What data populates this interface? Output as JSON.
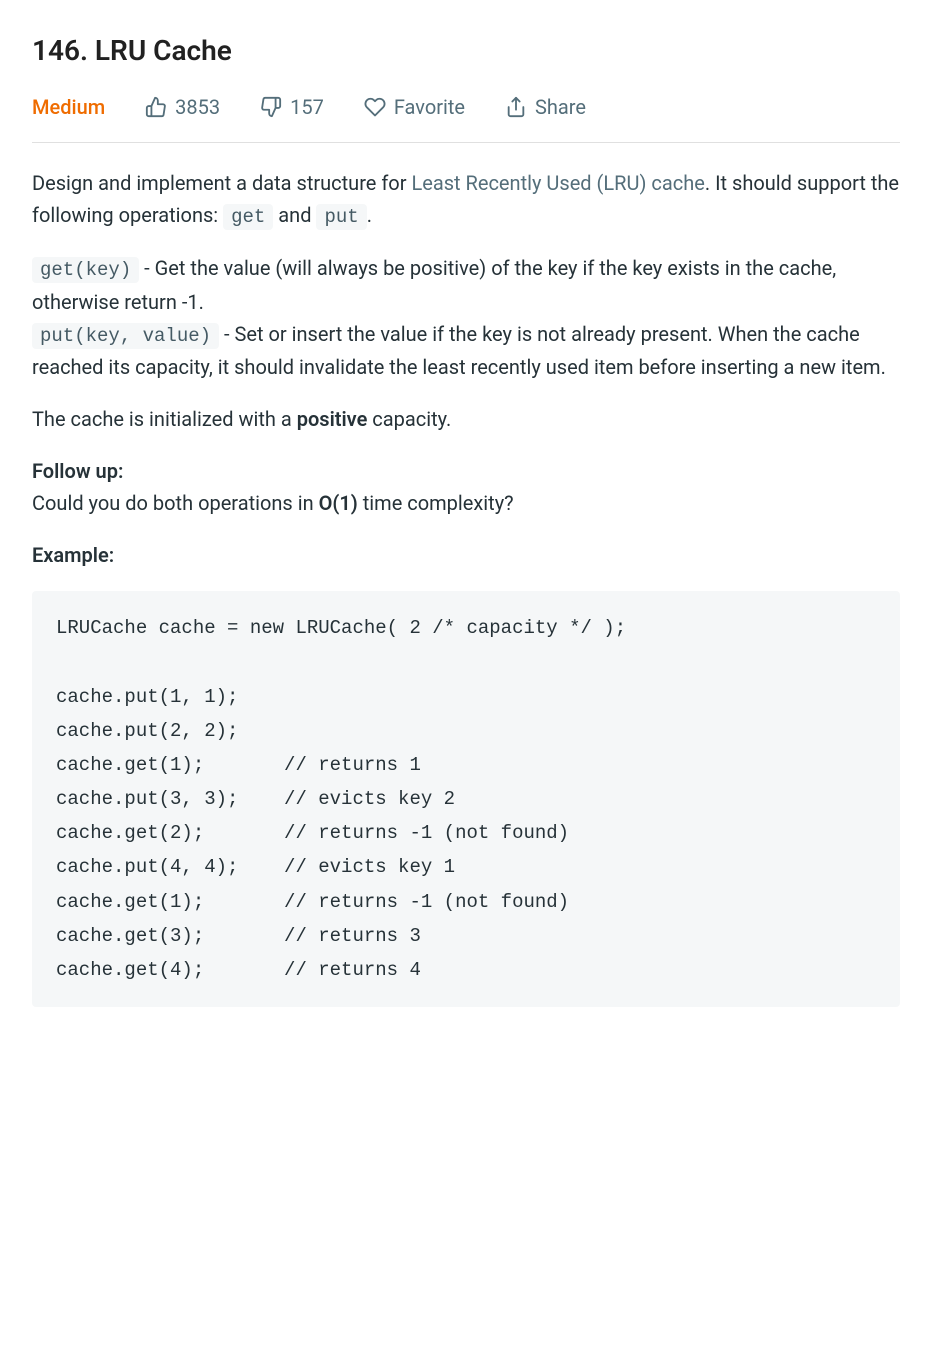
{
  "title": "146. LRU Cache",
  "meta": {
    "difficulty": "Medium",
    "likes": "3853",
    "dislikes": "157",
    "favorite": "Favorite",
    "share": "Share"
  },
  "body": {
    "intro_prefix": "Design and implement a data structure for ",
    "intro_link": "Least Recently Used (LRU) cache",
    "intro_mid": ". It should support the following operations: ",
    "code_get": "get",
    "intro_and": " and ",
    "code_put": "put",
    "intro_period": ".",
    "get_sig": "get(key)",
    "get_desc": " - Get the value (will always be positive) of the key if the key exists in the cache, otherwise return -1.",
    "put_sig": "put(key, value)",
    "put_desc": " - Set or insert the value if the key is not already present. When the cache reached its capacity, it should invalidate the least recently used item before inserting a new item.",
    "capacity_prefix": "The cache is initialized with a ",
    "capacity_bold": "positive",
    "capacity_suffix": " capacity.",
    "followup_label": "Follow up:",
    "followup_prefix": "Could you do both operations in ",
    "followup_bold": "O(1)",
    "followup_suffix": " time complexity?",
    "example_label": "Example:",
    "example_code": "LRUCache cache = new LRUCache( 2 /* capacity */ );\n\ncache.put(1, 1);\ncache.put(2, 2);\ncache.get(1);       // returns 1\ncache.put(3, 3);    // evicts key 2\ncache.get(2);       // returns -1 (not found)\ncache.put(4, 4);    // evicts key 1\ncache.get(1);       // returns -1 (not found)\ncache.get(3);       // returns 3\ncache.get(4);       // returns 4"
  }
}
